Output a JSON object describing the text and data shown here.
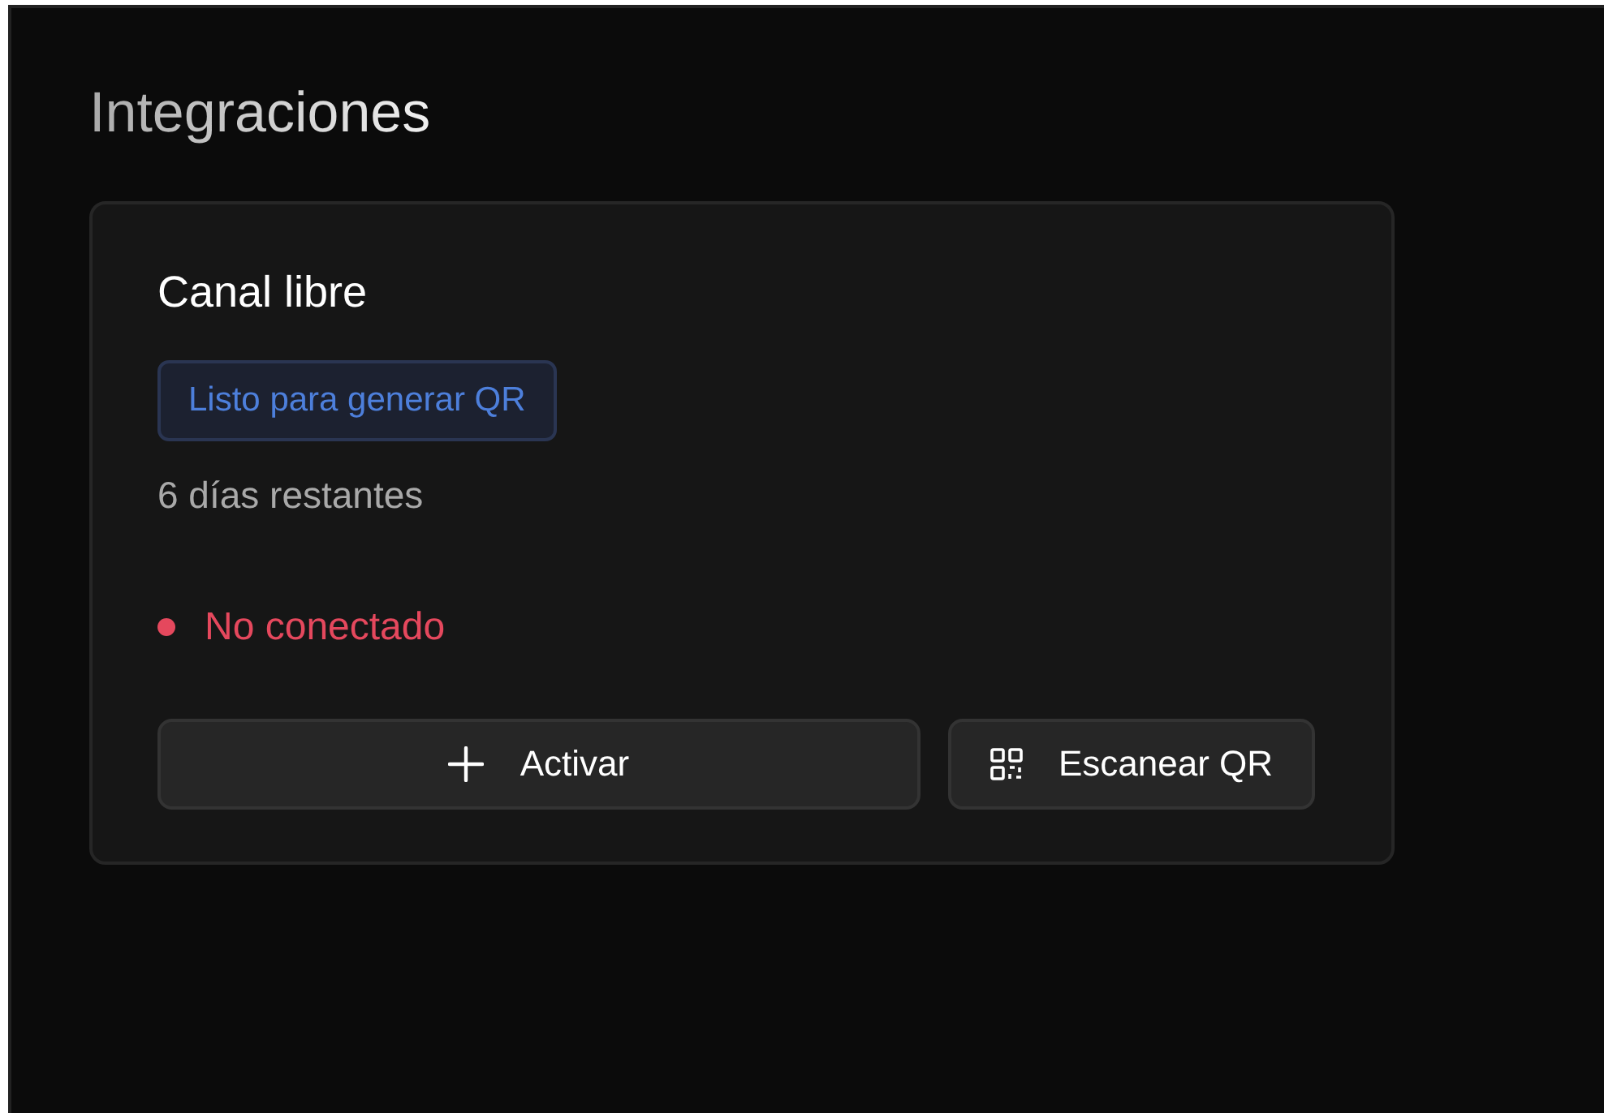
{
  "page": {
    "title": "Integraciones"
  },
  "card": {
    "title": "Canal libre",
    "badge": "Listo para generar QR",
    "remaining": "6 días restantes",
    "status": {
      "label": "No conectado",
      "connected": false
    },
    "buttons": [
      {
        "kind": "add",
        "label": "Activar"
      },
      {
        "kind": "qr",
        "label": "Escanear QR"
      }
    ]
  }
}
